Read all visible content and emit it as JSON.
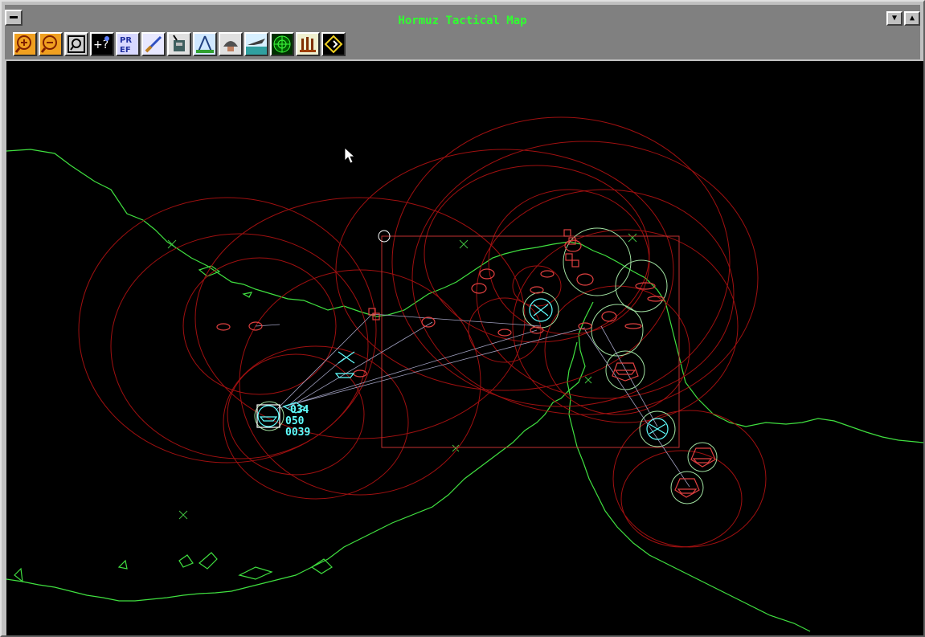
{
  "window": {
    "title": "Hormuz Tactical Map"
  },
  "titlebar": {
    "minimize_glyph": "▼",
    "maximize_glyph": "▲"
  },
  "toolbar": {
    "buttons": [
      {
        "name": "zoom-in-icon",
        "text": "+"
      },
      {
        "name": "zoom-out-icon",
        "text": "−"
      },
      {
        "name": "zoom-fit-icon",
        "text": ""
      },
      {
        "name": "waypoint-icon",
        "text": ""
      },
      {
        "name": "preferences-icon",
        "text": "PR\nEF"
      },
      {
        "name": "brush-icon",
        "text": ""
      },
      {
        "name": "radio-icon",
        "text": ""
      },
      {
        "name": "compass-icon",
        "text": ""
      },
      {
        "name": "helmet-icon",
        "text": ""
      },
      {
        "name": "aircraft-icon",
        "text": ""
      },
      {
        "name": "radar-icon",
        "text": ""
      },
      {
        "name": "missile-icon",
        "text": ""
      },
      {
        "name": "diamond-icon",
        "text": ""
      }
    ]
  },
  "unit_label": {
    "line1": "034",
    "line2": "050",
    "line3": "0039"
  },
  "colors": {
    "coast": "#40e040",
    "range_ring": "#a01010",
    "enemy_unit": "#e04040",
    "friendly_unit": "#60ffff",
    "sensor_ring": "#a0e0a0",
    "title_text": "#30ff30"
  }
}
